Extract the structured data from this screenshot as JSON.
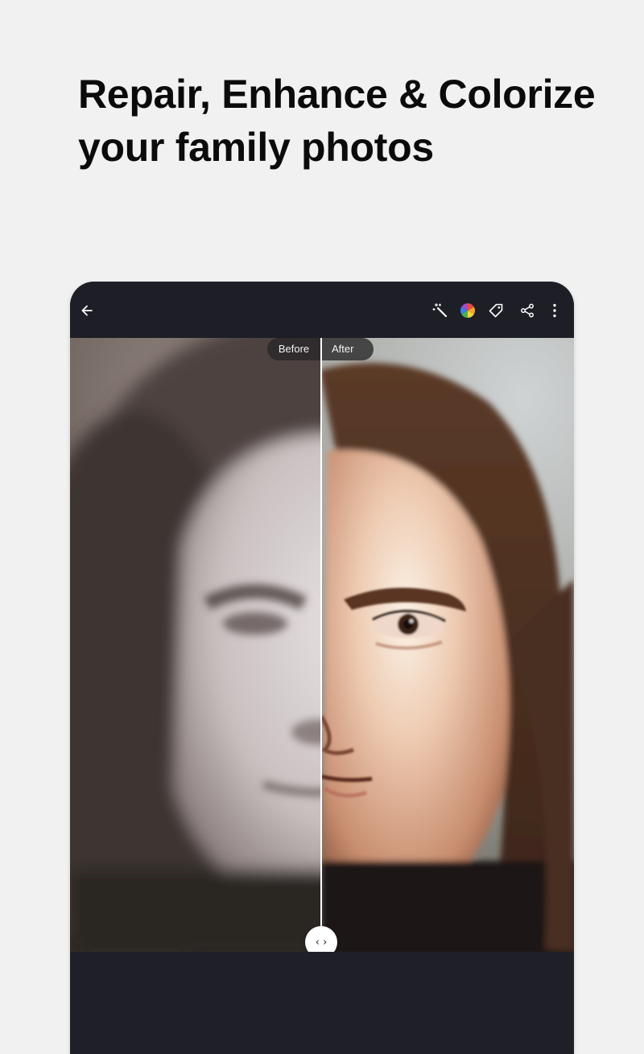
{
  "headline": {
    "line1": "Repair, Enhance & Colorize",
    "line2": "your family photos"
  },
  "toolbar": {
    "back_icon": "arrow-back-icon",
    "actions": [
      "magic-wand-icon",
      "color-wheel-icon",
      "tag-icon",
      "share-icon",
      "more-vert-icon"
    ]
  },
  "compare": {
    "before_label": "Before",
    "after_label": "After",
    "handle_label": "‹ ›",
    "split_fraction": 0.5
  },
  "colors": {
    "page_background": "#f1f1f1",
    "device_background": "#1f2026",
    "headline_text": "#0b0b0b"
  }
}
